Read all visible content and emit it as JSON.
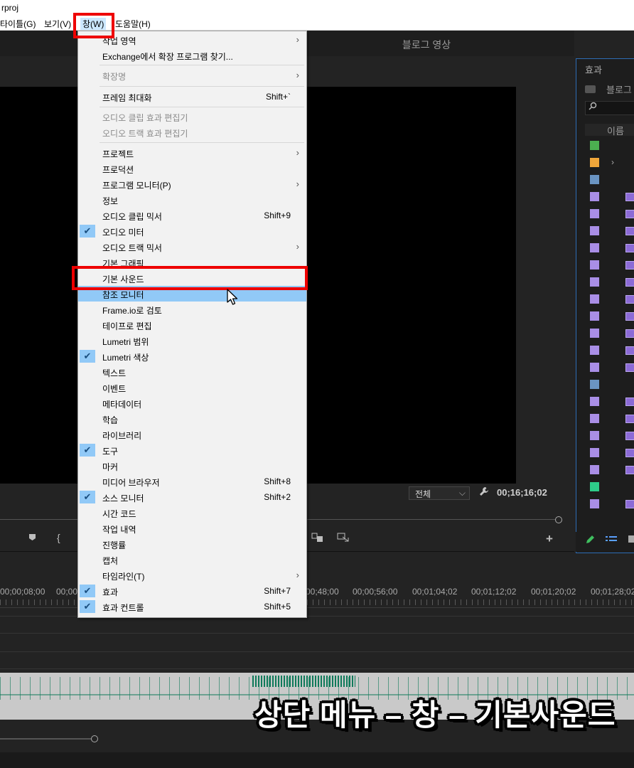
{
  "title_bar": {
    "text": "rproj"
  },
  "menubar": {
    "items": [
      {
        "label": "타이틀(G)"
      },
      {
        "label": "보기(V)"
      },
      {
        "label": "창(W)"
      },
      {
        "label": "도움말(H)"
      }
    ]
  },
  "program_monitor": {
    "sequence_title": "블로그 영상",
    "fit_value": "전체",
    "timecode": "00;16;16;02"
  },
  "effects_panel": {
    "title": "효과",
    "bin_label": "블로그",
    "column_name": "이름"
  },
  "timeline": {
    "ruler_labels": [
      "00;00;08;00",
      "00;00",
      "00;48;00",
      "00;00;56;00",
      "00;01;04;02",
      "00;01;12;02",
      "00;01;20;02",
      "00;01;28;02"
    ]
  },
  "window_menu": {
    "items": [
      {
        "label": "작업 영역",
        "submenu": true
      },
      {
        "label": "Exchange에서 확장 프로그램 찾기..."
      },
      {
        "label": "확장명",
        "submenu": true,
        "disabled": true
      },
      {
        "label": "프레임 최대화",
        "shortcut": "Shift+`"
      },
      {
        "label": "오디오 클립 효과 편집기",
        "disabled": true
      },
      {
        "label": "오디오 트랙 효과 편집기",
        "disabled": true
      },
      {
        "label": "프로젝트",
        "submenu": true
      },
      {
        "label": "프로덕션"
      },
      {
        "label": "프로그램 모니터(P)",
        "submenu": true
      },
      {
        "label": "정보"
      },
      {
        "label": "오디오 클립 믹서",
        "shortcut": "Shift+9"
      },
      {
        "label": "오디오 미터",
        "checked": true
      },
      {
        "label": "오디오 트랙 믹서",
        "submenu": true
      },
      {
        "label": "기본 그래픽"
      },
      {
        "label": "기본 사운드"
      },
      {
        "label": "참조 모니터",
        "highlighted": true
      },
      {
        "label": "Frame.io로 검토"
      },
      {
        "label": "테이프로 편집"
      },
      {
        "label": "Lumetri 범위"
      },
      {
        "label": "Lumetri 색상",
        "checked": true
      },
      {
        "label": "텍스트"
      },
      {
        "label": "이벤트"
      },
      {
        "label": "메타데이터"
      },
      {
        "label": "학습"
      },
      {
        "label": "라이브러리"
      },
      {
        "label": "도구",
        "checked": true
      },
      {
        "label": "마커"
      },
      {
        "label": "미디어 브라우저",
        "shortcut": "Shift+8"
      },
      {
        "label": "소스 모니터",
        "shortcut": "Shift+2",
        "checked": true
      },
      {
        "label": "시간 코드"
      },
      {
        "label": "작업 내역"
      },
      {
        "label": "진행률"
      },
      {
        "label": "캡처"
      },
      {
        "label": "타임라인(T)",
        "submenu": true
      },
      {
        "label": "효과",
        "shortcut": "Shift+7",
        "checked": true
      },
      {
        "label": "효과 컨트롤",
        "shortcut": "Shift+5",
        "checked": true
      }
    ]
  },
  "caption": {
    "text": "상단 메뉴 – 창 – 기본사운드"
  },
  "colors": {
    "highlight": "#91c9f7",
    "annotation_red": "#ee0000",
    "panel_border": "#2d6cb5"
  },
  "icons": [
    "search-icon",
    "wrench-icon",
    "check-icon",
    "chevron-right-icon",
    "cursor-icon",
    "marker-icon",
    "plus-icon",
    "pencil-icon",
    "list-view-icon"
  ]
}
